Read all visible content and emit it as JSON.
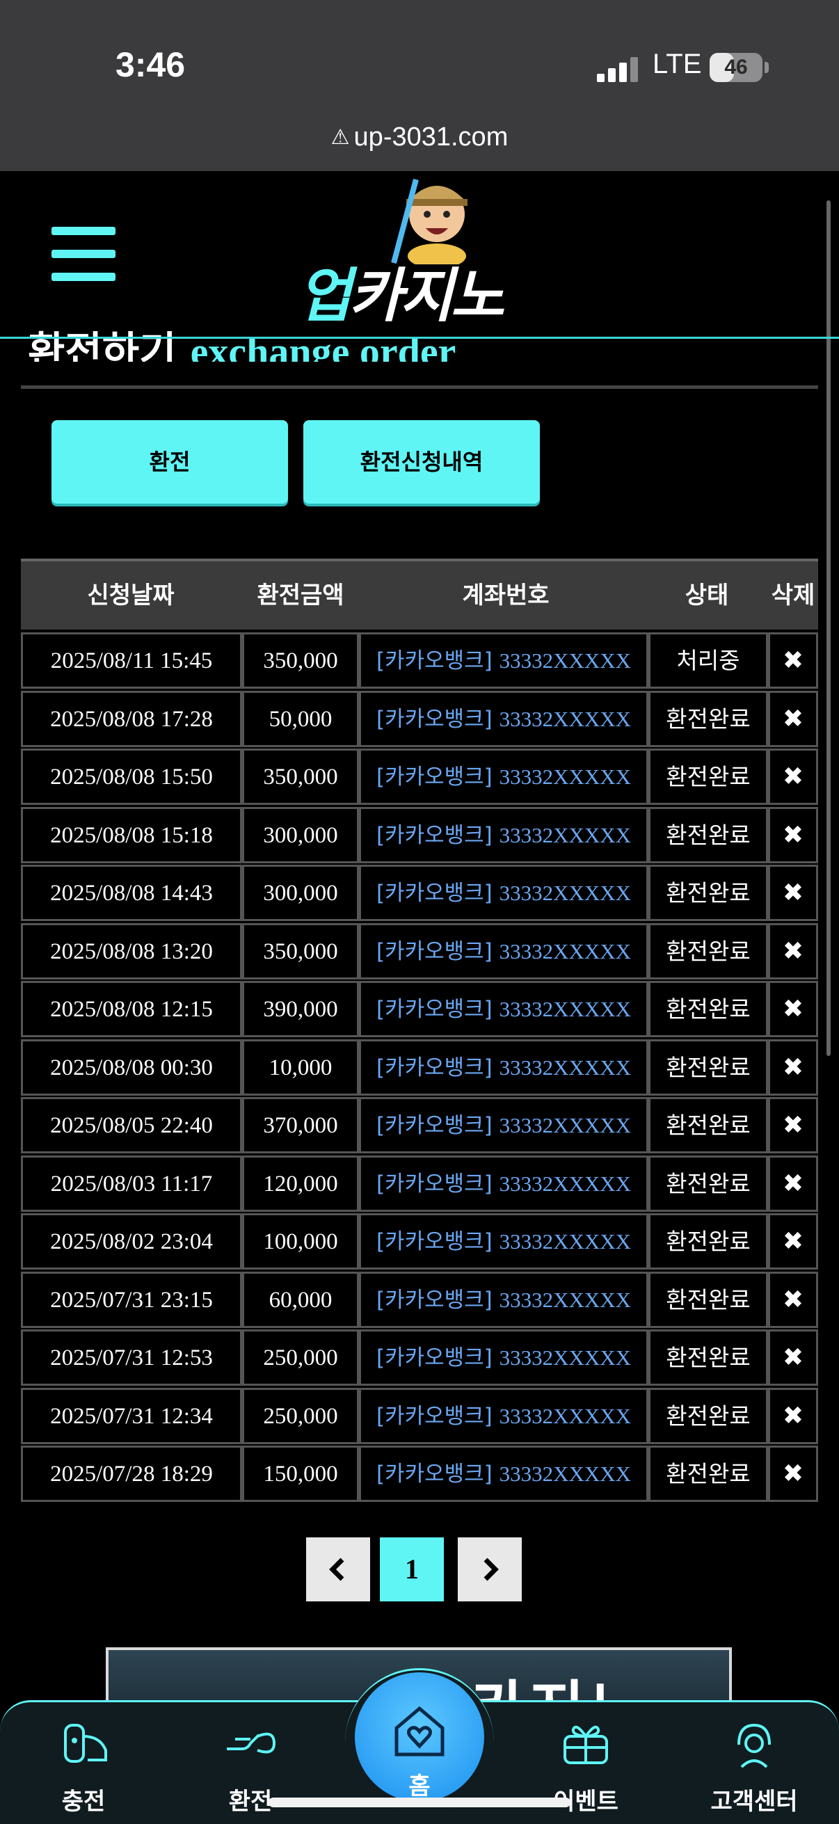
{
  "status_bar": {
    "time": "3:46",
    "network": "LTE",
    "battery": "46",
    "battery_level": 0.46
  },
  "browser": {
    "url": "up-3031.com",
    "insecure_icon": "warning-triangle-icon"
  },
  "header": {
    "logo_text_up": "업",
    "logo_text_rest": "카지노",
    "menu_icon": "hamburger-icon"
  },
  "section": {
    "title_ko": "환전하기",
    "title_en": "exchange order"
  },
  "buttons": {
    "exchange": "환전",
    "history": "환전신청내역"
  },
  "table": {
    "columns": [
      "신청날짜",
      "환전금액",
      "계좌번호",
      "상태",
      "삭제"
    ],
    "delete_glyph": "✖",
    "rows": [
      {
        "date": "2025/08/11 15:45",
        "amount": "350,000",
        "bank": "[카카오뱅크]",
        "account": "33332XXXXX",
        "status": "처리중"
      },
      {
        "date": "2025/08/08 17:28",
        "amount": "50,000",
        "bank": "[카카오뱅크]",
        "account": "33332XXXXX",
        "status": "환전완료"
      },
      {
        "date": "2025/08/08 15:50",
        "amount": "350,000",
        "bank": "[카카오뱅크]",
        "account": "33332XXXXX",
        "status": "환전완료"
      },
      {
        "date": "2025/08/08 15:18",
        "amount": "300,000",
        "bank": "[카카오뱅크]",
        "account": "33332XXXXX",
        "status": "환전완료"
      },
      {
        "date": "2025/08/08 14:43",
        "amount": "300,000",
        "bank": "[카카오뱅크]",
        "account": "33332XXXXX",
        "status": "환전완료"
      },
      {
        "date": "2025/08/08 13:20",
        "amount": "350,000",
        "bank": "[카카오뱅크]",
        "account": "33332XXXXX",
        "status": "환전완료"
      },
      {
        "date": "2025/08/08 12:15",
        "amount": "390,000",
        "bank": "[카카오뱅크]",
        "account": "33332XXXXX",
        "status": "환전완료"
      },
      {
        "date": "2025/08/08 00:30",
        "amount": "10,000",
        "bank": "[카카오뱅크]",
        "account": "33332XXXXX",
        "status": "환전완료"
      },
      {
        "date": "2025/08/05 22:40",
        "amount": "370,000",
        "bank": "[카카오뱅크]",
        "account": "33332XXXXX",
        "status": "환전완료"
      },
      {
        "date": "2025/08/03 11:17",
        "amount": "120,000",
        "bank": "[카카오뱅크]",
        "account": "33332XXXXX",
        "status": "환전완료"
      },
      {
        "date": "2025/08/02 23:04",
        "amount": "100,000",
        "bank": "[카카오뱅크]",
        "account": "33332XXXXX",
        "status": "환전완료"
      },
      {
        "date": "2025/07/31 23:15",
        "amount": "60,000",
        "bank": "[카카오뱅크]",
        "account": "33332XXXXX",
        "status": "환전완료"
      },
      {
        "date": "2025/07/31 12:53",
        "amount": "250,000",
        "bank": "[카카오뱅크]",
        "account": "33332XXXXX",
        "status": "환전완료"
      },
      {
        "date": "2025/07/31 12:34",
        "amount": "250,000",
        "bank": "[카카오뱅크]",
        "account": "33332XXXXX",
        "status": "환전완료"
      },
      {
        "date": "2025/07/28 18:29",
        "amount": "150,000",
        "bank": "[카카오뱅크]",
        "account": "33332XXXXX",
        "status": "환전완료"
      }
    ]
  },
  "pagination": {
    "prev_glyph": "‹",
    "current": "1",
    "next_glyph": "›"
  },
  "banner": {
    "text": "카지노"
  },
  "bottom_nav": {
    "charge": "충전",
    "exchange": "환전",
    "home": "홈",
    "event": "이벤트",
    "support": "고객센터"
  },
  "colors": {
    "accent": "#5ff5f5",
    "account_link": "#6aa7f2",
    "home_button": "#1a8ff0"
  }
}
